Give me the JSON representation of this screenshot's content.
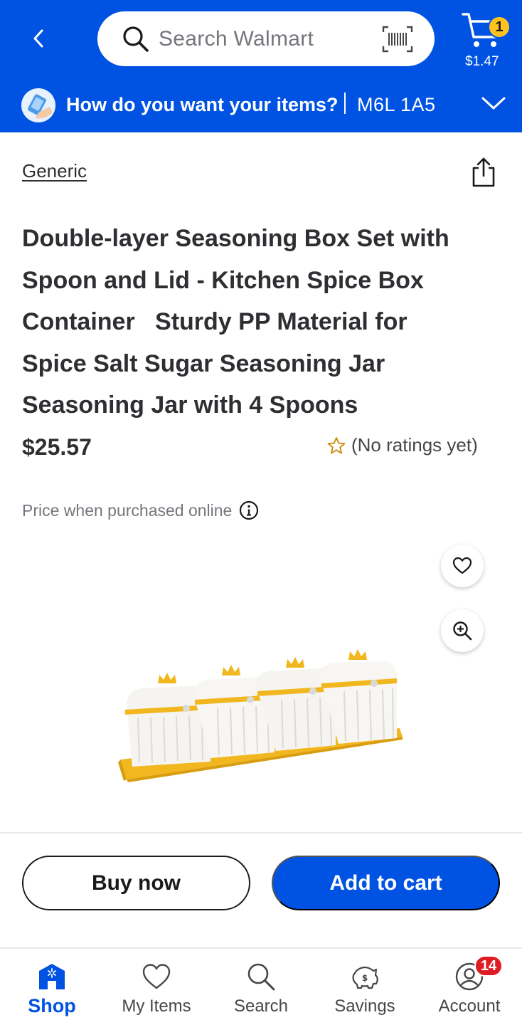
{
  "header": {
    "search_placeholder": "Search Walmart",
    "cart_count": "1",
    "cart_amount": "$1.47",
    "delivery_question": "How do you want your items?",
    "postal_code": "M6L 1A5",
    "colors": {
      "brand_blue": "#0053e2",
      "spark_yellow": "#ffc220"
    }
  },
  "product": {
    "brand": "Generic",
    "title": "Double-layer Seasoning Box Set with Spoon and Lid - Kitchen Spice Box Container   Sturdy PP Material for Spice Salt Sugar Seasoning Jar Seasoning Jar with 4 Spoons",
    "price": "$25.57",
    "ratings_text": "(No ratings yet)",
    "price_note": "Price when purchased online"
  },
  "actions": {
    "buy_now": "Buy now",
    "add_to_cart": "Add to cart"
  },
  "bottom_nav": {
    "items": [
      {
        "label": "Shop",
        "icon": "shop-icon",
        "active": true
      },
      {
        "label": "My Items",
        "icon": "heart-icon"
      },
      {
        "label": "Search",
        "icon": "search-icon"
      },
      {
        "label": "Savings",
        "icon": "savings-icon"
      },
      {
        "label": "Account",
        "icon": "account-icon"
      }
    ],
    "account_badge": "14"
  }
}
